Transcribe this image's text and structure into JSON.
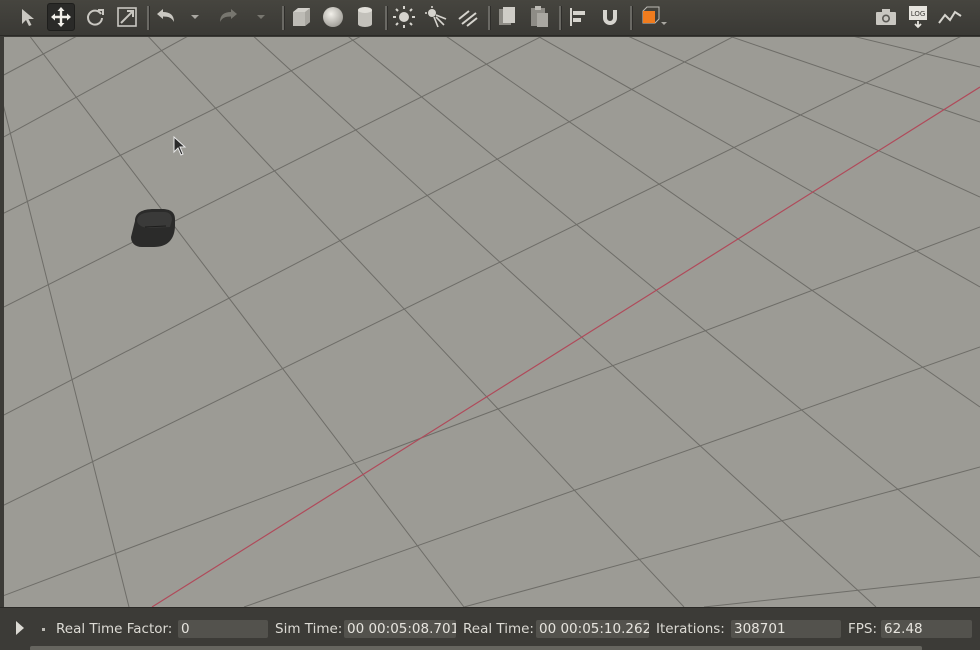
{
  "toolbar": {
    "tools": [
      {
        "name": "select-mode-icon",
        "active": false
      },
      {
        "name": "translate-mode-icon",
        "active": true
      },
      {
        "name": "rotate-mode-icon",
        "active": false
      },
      {
        "name": "scale-mode-icon",
        "active": false
      },
      {
        "name": "undo-icon",
        "active": false
      },
      {
        "name": "undo-history-dropdown-icon",
        "active": false
      },
      {
        "name": "redo-icon",
        "active": false
      },
      {
        "name": "redo-history-dropdown-icon",
        "active": false
      },
      {
        "name": "box-shape-icon",
        "active": false
      },
      {
        "name": "sphere-shape-icon",
        "active": false
      },
      {
        "name": "cylinder-shape-icon",
        "active": false
      },
      {
        "name": "point-light-icon",
        "active": false
      },
      {
        "name": "spot-light-icon",
        "active": false
      },
      {
        "name": "directional-light-icon",
        "active": false
      },
      {
        "name": "copy-icon",
        "active": false
      },
      {
        "name": "paste-icon",
        "active": false
      },
      {
        "name": "align-icon",
        "active": false
      },
      {
        "name": "snap-magnet-icon",
        "active": false
      },
      {
        "name": "view-angle-icon",
        "active": false
      },
      {
        "name": "screenshot-camera-icon",
        "active": false
      },
      {
        "name": "log-recorder-icon",
        "active": false
      },
      {
        "name": "plot-icon",
        "active": false
      }
    ],
    "accent_color": "#f07c1e",
    "log_label": "LOG"
  },
  "viewport": {
    "background_color": "#9c9b95",
    "grid_color": "#6e6d68",
    "x_axis_color": "#b04a5a",
    "object_icon": "robot-model",
    "cursor_icon": "mouse-pointer-icon"
  },
  "statusbar": {
    "play_icon": "play-icon",
    "real_time_factor_label": "Real Time Factor:",
    "real_time_factor_value": "0",
    "sim_time_label": "Sim Time:",
    "sim_time_value": "00 00:05:08.701",
    "real_time_label": "Real Time:",
    "real_time_value": "00 00:05:10.262",
    "iterations_label": "Iterations:",
    "iterations_value": "308701",
    "fps_label": "FPS:",
    "fps_value": "62.48"
  }
}
